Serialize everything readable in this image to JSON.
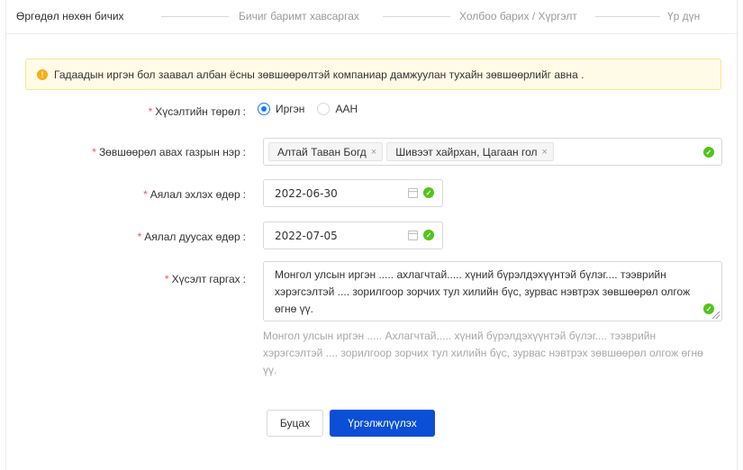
{
  "steps": [
    {
      "label": "Өргөдөл нөхөн бичих",
      "active": true
    },
    {
      "label": "Бичиг баримт хавсаргах",
      "active": false
    },
    {
      "label": "Холбоо барих / Хүргэлт",
      "active": false
    },
    {
      "label": "Үр дүн",
      "active": false
    }
  ],
  "alert": {
    "icon": "exclamation-circle-icon",
    "text": "Гадаадын иргэн бол заавал албан ёсны зөвшөөрөлтэй компаниар дамжуулан тухайн зөвшөөрлийг авна ."
  },
  "form": {
    "applicant_type": {
      "label": "Хүсэлтийн төрөл",
      "options": [
        "Иргэн",
        "ААН"
      ],
      "selected": "Иргэн"
    },
    "place": {
      "label": "Зөвшөөрөл авах газрын нэр",
      "tags": [
        "Алтай Таван Богд",
        "Шивээт хайрхан, Цагаан гол"
      ],
      "close_glyph": "×"
    },
    "start_date": {
      "label": "Аялал эхлэх өдөр",
      "value": "2022-06-30"
    },
    "end_date": {
      "label": "Аялал дуусах өдөр",
      "value": "2022-07-05"
    },
    "request": {
      "label": "Хүсэлт гаргах",
      "value": "Монгол улсын иргэн ..... ахлагчтай..... хүний бүрэлдэхүүнтэй бүлэг.... тээврийн хэрэгсэлтэй .... зорилгоор зорчих тул хилийн бүс, зурвас нэвтрэх зөвшөөрөл олгож өгнө үү.",
      "helper": "Монгол улсын иргэн ..... Ахлагчтай..... хүний бүрэлдэхүүнтэй бүлэг.... тээврийн хэрэгсэлтэй .... зорилгоор зорчих тул хилийн бүс, зурвас нэвтрэх зөвшөөрөл олгож өгнө үү."
    },
    "required_mark": "*",
    "colon": ":"
  },
  "buttons": {
    "back": "Буцах",
    "next": "Үргэлжлүүлэх"
  },
  "colors": {
    "primary": "#0a4fd6",
    "success": "#52c41a",
    "warning": "#faad14",
    "required": "#ff4d4f"
  }
}
